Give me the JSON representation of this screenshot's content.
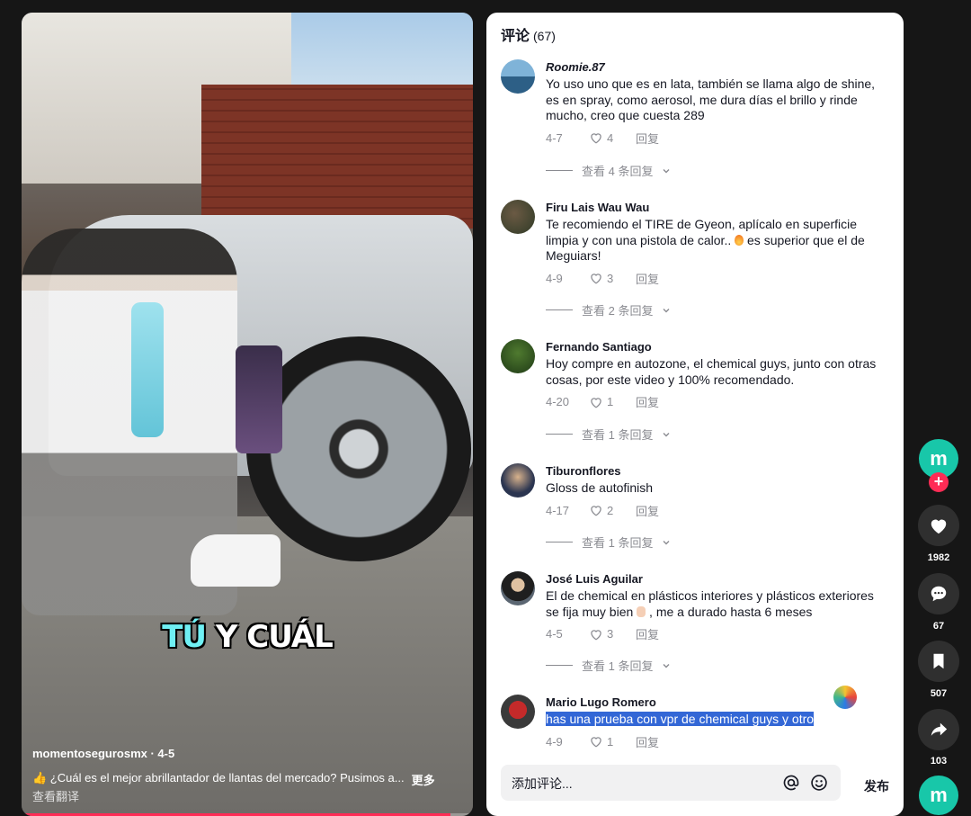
{
  "video": {
    "caption_highlight": "TÚ",
    "caption_rest": " Y CUÁL",
    "author": "momentosegurosmx · 4-5",
    "description": "👍 ¿Cuál es el mejor abrillantador de llantas del mercado? Pusimos a...",
    "more_label": "更多",
    "translate_label": "查看翻译",
    "progress": 0.95
  },
  "comments_panel": {
    "title": "评论",
    "count": "(67)",
    "comments": [
      {
        "name": "Roomie.87",
        "text": "Yo uso uno que es en lata, también se llama algo de shine, es en spray, como aerosol, me dura días el brillo y rinde mucho, creo que cuesta 289",
        "date": "4-7",
        "likes": "4",
        "reply": "回复",
        "view_replies": "查看 4 条回复"
      },
      {
        "name": "Firu Lais Wau Wau",
        "text_a": "Te recomiendo el TIRE de Gyeon, aplícalo en superficie limpia y con una pistola de calor.. ",
        "text_b": " es superior que el de Meguiars!",
        "date": "4-9",
        "likes": "3",
        "reply": "回复",
        "view_replies": "查看 2 条回复"
      },
      {
        "name": "Fernando Santiago",
        "text": "Hoy compre en autozone, el chemical guys, junto con otras cosas, por este video y 100% recomendado.",
        "date": "4-20",
        "likes": "1",
        "reply": "回复",
        "view_replies": "查看 1 条回复"
      },
      {
        "name": "Tiburonflores",
        "text": "Gloss de autofinish",
        "date": "4-17",
        "likes": "2",
        "reply": "回复",
        "view_replies": "查看 1 条回复"
      },
      {
        "name": "José Luis Aguilar",
        "text_a": "El de chemical en plásticos interiores y plásticos exteriores se fija muy bien ",
        "text_b": " , me a durado hasta 6 meses",
        "date": "4-5",
        "likes": "3",
        "reply": "回复",
        "view_replies": "查看 1 条回复"
      },
      {
        "name": "Mario Lugo Romero",
        "text": "has una prueba con vpr de chemical guys y otro",
        "date": "4-9",
        "likes": "1",
        "reply": "回复"
      }
    ],
    "input_placeholder": "添加评论...",
    "post_label": "发布"
  },
  "rail": {
    "avatar_text": "m",
    "likes": "1982",
    "comments": "67",
    "saves": "507",
    "shares": "103"
  },
  "colors": {
    "accent": "#fe2c55",
    "brand": "#18c7a9",
    "selection": "#3367d6"
  }
}
